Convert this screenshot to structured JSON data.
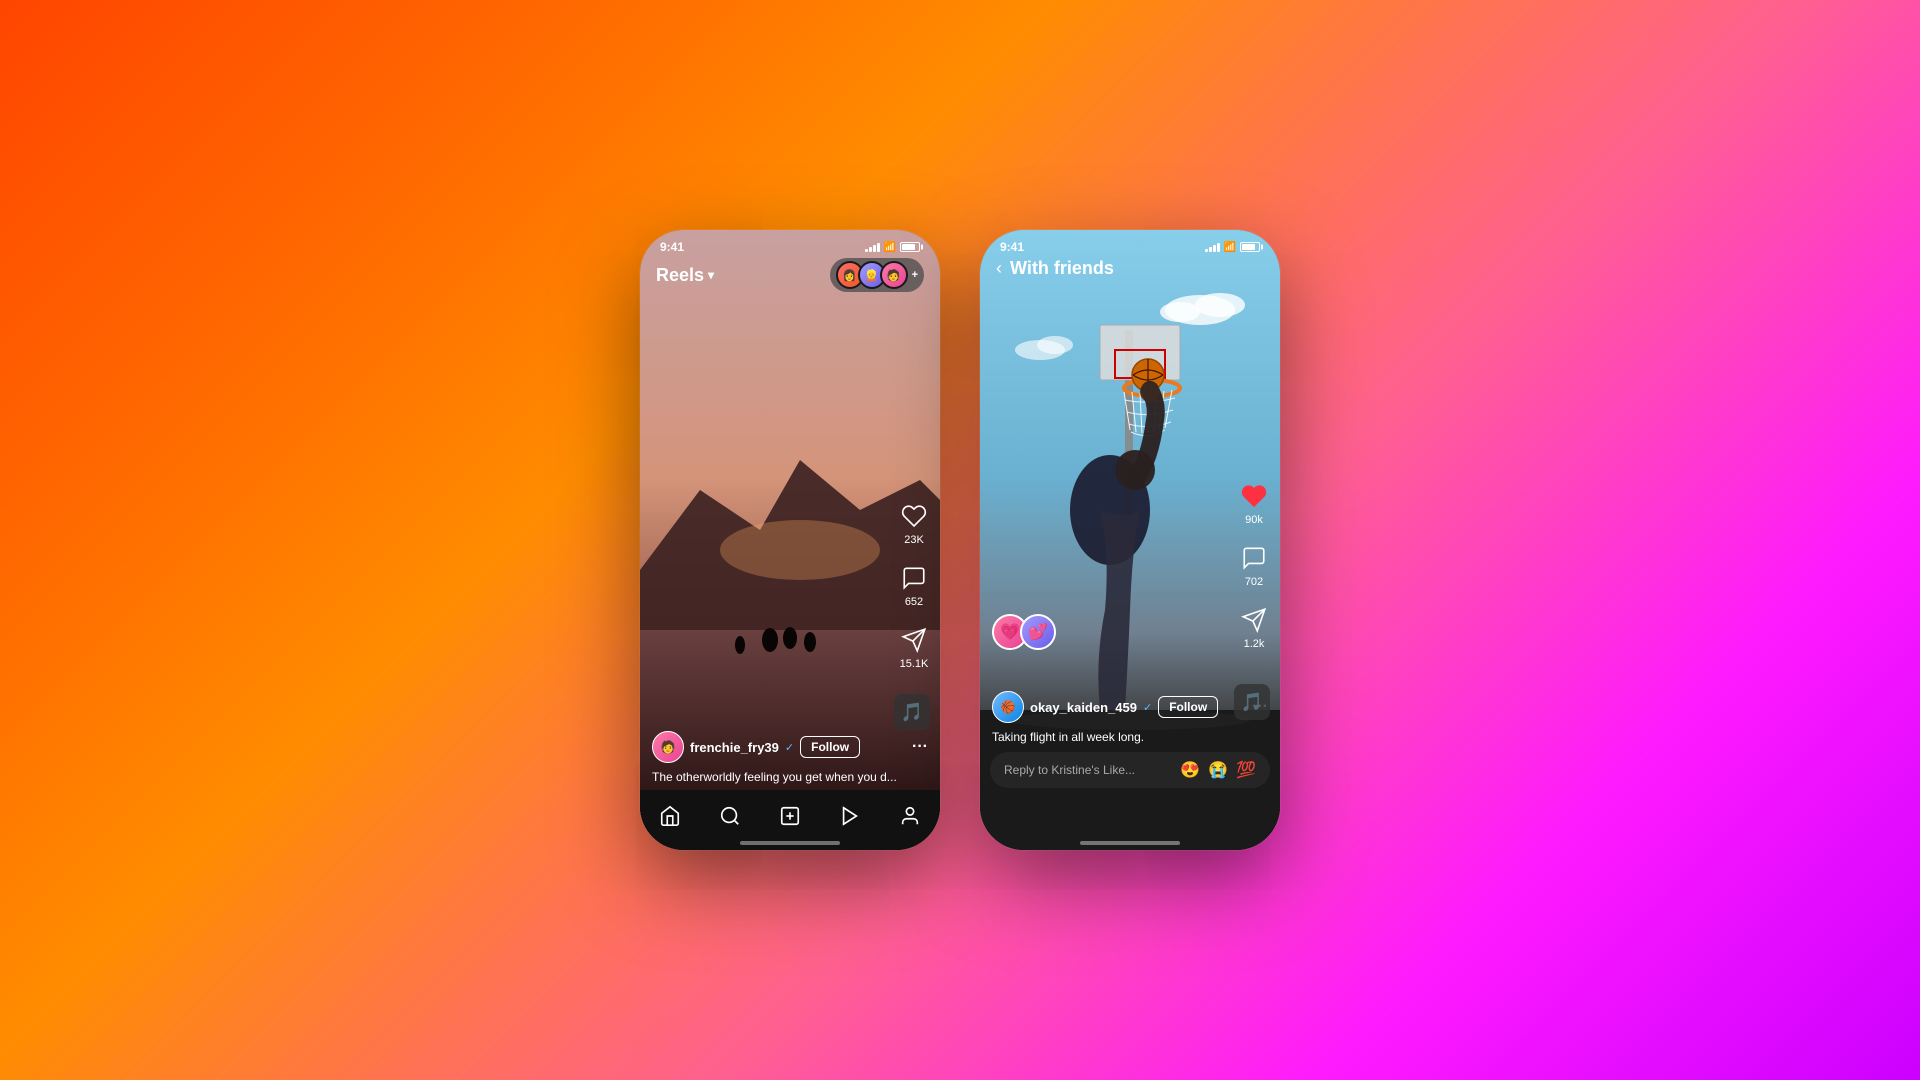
{
  "background": {
    "gradient": "linear-gradient(135deg, #ff4500, #ff8c00, #ff6090, #cc00ff)"
  },
  "phone1": {
    "status": {
      "time": "9:41",
      "signal": true,
      "wifi": true,
      "battery": true
    },
    "header": {
      "title": "Reels",
      "chevron": "▾"
    },
    "actions": {
      "likes": "23K",
      "comments": "652",
      "shares": "15.1K"
    },
    "user": {
      "name": "frenchie_fry39",
      "verified": true,
      "follow_label": "Follow"
    },
    "caption": "The otherworldly feeling you get when you d...",
    "nav": {
      "home": "home",
      "search": "search",
      "add": "add",
      "reels": "reels",
      "profile": "profile"
    }
  },
  "phone2": {
    "status": {
      "time": "9:41",
      "signal": true,
      "wifi": true,
      "battery": true
    },
    "header": {
      "back_label": "‹",
      "title": "With friends"
    },
    "actions": {
      "likes": "90k",
      "comments": "702",
      "shares": "1.2k"
    },
    "user": {
      "name": "okay_kaiden_459",
      "verified": true,
      "follow_label": "Follow"
    },
    "caption": "Taking flight in all week long.",
    "reply_placeholder": "Reply to Kristine's Like...",
    "reply_emojis": [
      "😍",
      "😭",
      "💯"
    ]
  }
}
